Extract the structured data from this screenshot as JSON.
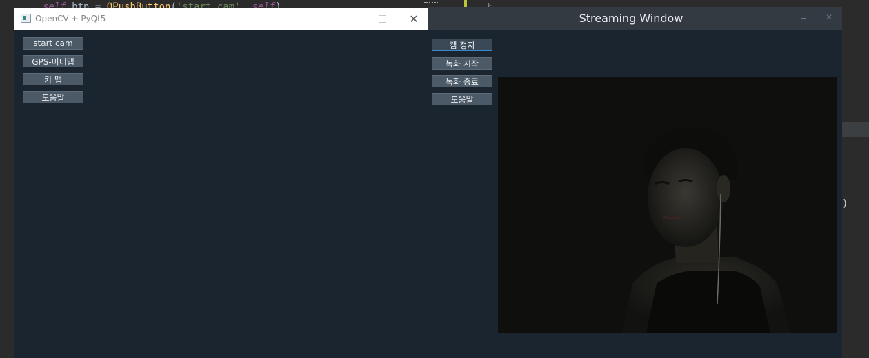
{
  "ide": {
    "code_self": "self",
    "code_mid": ".btn = ",
    "code_fn": "QPushButton",
    "code_open": "(",
    "code_str": "'start cam'",
    "code_comma": ", ",
    "code_self2": "self",
    "code_close": ")",
    "side_char": "F",
    "paren": ")"
  },
  "window1": {
    "title": "OpenCV + PyQt5",
    "buttons": [
      "start cam",
      "GPS-미니맵",
      "키 맵",
      "도움말"
    ]
  },
  "window2": {
    "title": "Streaming Window",
    "buttons": [
      "캠 정지",
      "녹화 시작",
      "녹화 종료",
      "도움말"
    ]
  },
  "colors": {
    "window_bg": "#1b2530",
    "button_bg": "#4c5966",
    "active_border": "#3b8ad0",
    "titlebar2_bg": "#333a42"
  },
  "icons": [
    "app-icon",
    "minimize-icon",
    "maximize-icon",
    "close-icon"
  ]
}
